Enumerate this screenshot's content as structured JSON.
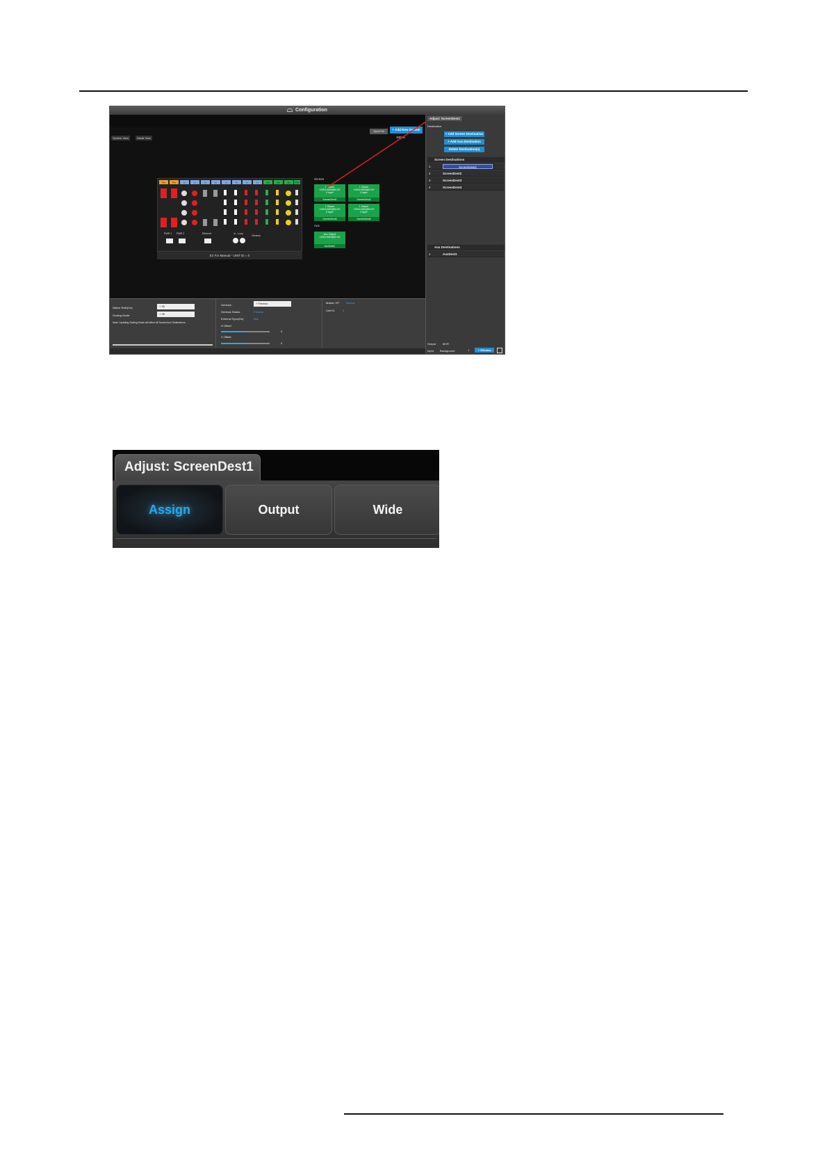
{
  "screenshot1": {
    "window_title": "Configuration",
    "top_buttons": {
      "sync_failed": "SyncFail",
      "add_new_system": "+ Add New System"
    },
    "view_tabs": [
      "System View",
      "Detail View"
    ],
    "zoom": "100 %",
    "slot_labels": [
      "Pwr",
      "Pwr",
      "In",
      "In",
      "In",
      "In",
      "In",
      "In",
      "In",
      "In",
      "Out",
      "Out",
      "Out",
      "MVR"
    ],
    "port_labels": [
      "PWR 1",
      "PWR 2",
      "Ethernet",
      "In - Loop",
      "Genlock"
    ],
    "chassis_footer": "E2 For Manual - UNIT ID = 0",
    "screen_label": "Screen",
    "aux_label": "Aux",
    "screen_outputs": [
      {
        "line1": "1 Output",
        "line2": "1920x1080@60.00",
        "line3": "0 layer",
        "dest": "ScreenDest1"
      },
      {
        "line1": "1 Output",
        "line2": "1920x1080@60.00",
        "line3": "0 layer",
        "dest": "ScreenDest2"
      },
      {
        "line1": "1 Output",
        "line2": "1920x1080@60.00",
        "line3": "0 layer",
        "dest": "ScreenDest3"
      },
      {
        "line1": "1 Output",
        "line2": "1920x1080@60.00",
        "line3": "0 layer",
        "dest": "ScreenDest4"
      }
    ],
    "aux_output": {
      "line1": "Aux Output",
      "line2": "1920x1080@60.00",
      "dest": "AuxDest1"
    },
    "bottom_panel": {
      "native_rate_label": "Native Rate(Hz):",
      "native_rate_value": "+ 30",
      "scaling_mode_label": "Scaling Mode:",
      "scaling_mode_value": "+ 2K",
      "note": "Note: Updating Scaling Mode will affect all Screen/Aux Destinations.",
      "genlock_label": "Genlock:",
      "genlock_value": "+ Freerun",
      "genlock_status_label": "Genlock Status:",
      "genlock_status_value": "Freerun",
      "external_sync_label": "External Sync(Hz):",
      "external_sync_value": "N/A",
      "h_offset_label": "H Offset:",
      "h_offset_value": "0",
      "v_offset_label": "V Offset:",
      "v_offset_value": "0",
      "master_vp_label": "Master VP:",
      "master_vp_value": "Source",
      "unit_id_label": "Unit ID:",
      "unit_id_value": "0"
    },
    "right_panel": {
      "tab": "Adjust: ScreenDest1",
      "section_destination": "Destination",
      "add_screen_dest": "+ Add Screen Destination",
      "add_aux_dest": "+ Add Aux Destination",
      "delete_dest": "Delete Destination(s)",
      "screen_dest_header": "Screen Destinations",
      "screen_dests": [
        {
          "num": "1",
          "name": "ScreenDest1"
        },
        {
          "num": "2",
          "name": "ScreenDest2"
        },
        {
          "num": "3",
          "name": "ScreenDest3"
        },
        {
          "num": "4",
          "name": "ScreenDest4"
        }
      ],
      "aux_dest_header": "Aux Destinations",
      "aux_dests": [
        {
          "num": "1",
          "name": "AuxDest1"
        }
      ],
      "bottom_tabs": [
        "Output",
        "MVR"
      ],
      "bottom_tabs2": [
        "Input",
        "Background"
      ],
      "window_button": "+ Window",
      "page_num": "1"
    }
  },
  "screenshot2": {
    "header_tab": "Adjust: ScreenDest1",
    "buttons": [
      "Assign",
      "Output",
      "Wide"
    ]
  },
  "colors": {
    "accent_blue": "#1e90d6",
    "output_green": "#1aa34a",
    "assign_glow": "#2aa8e8",
    "annotation_red": "#e02020"
  }
}
